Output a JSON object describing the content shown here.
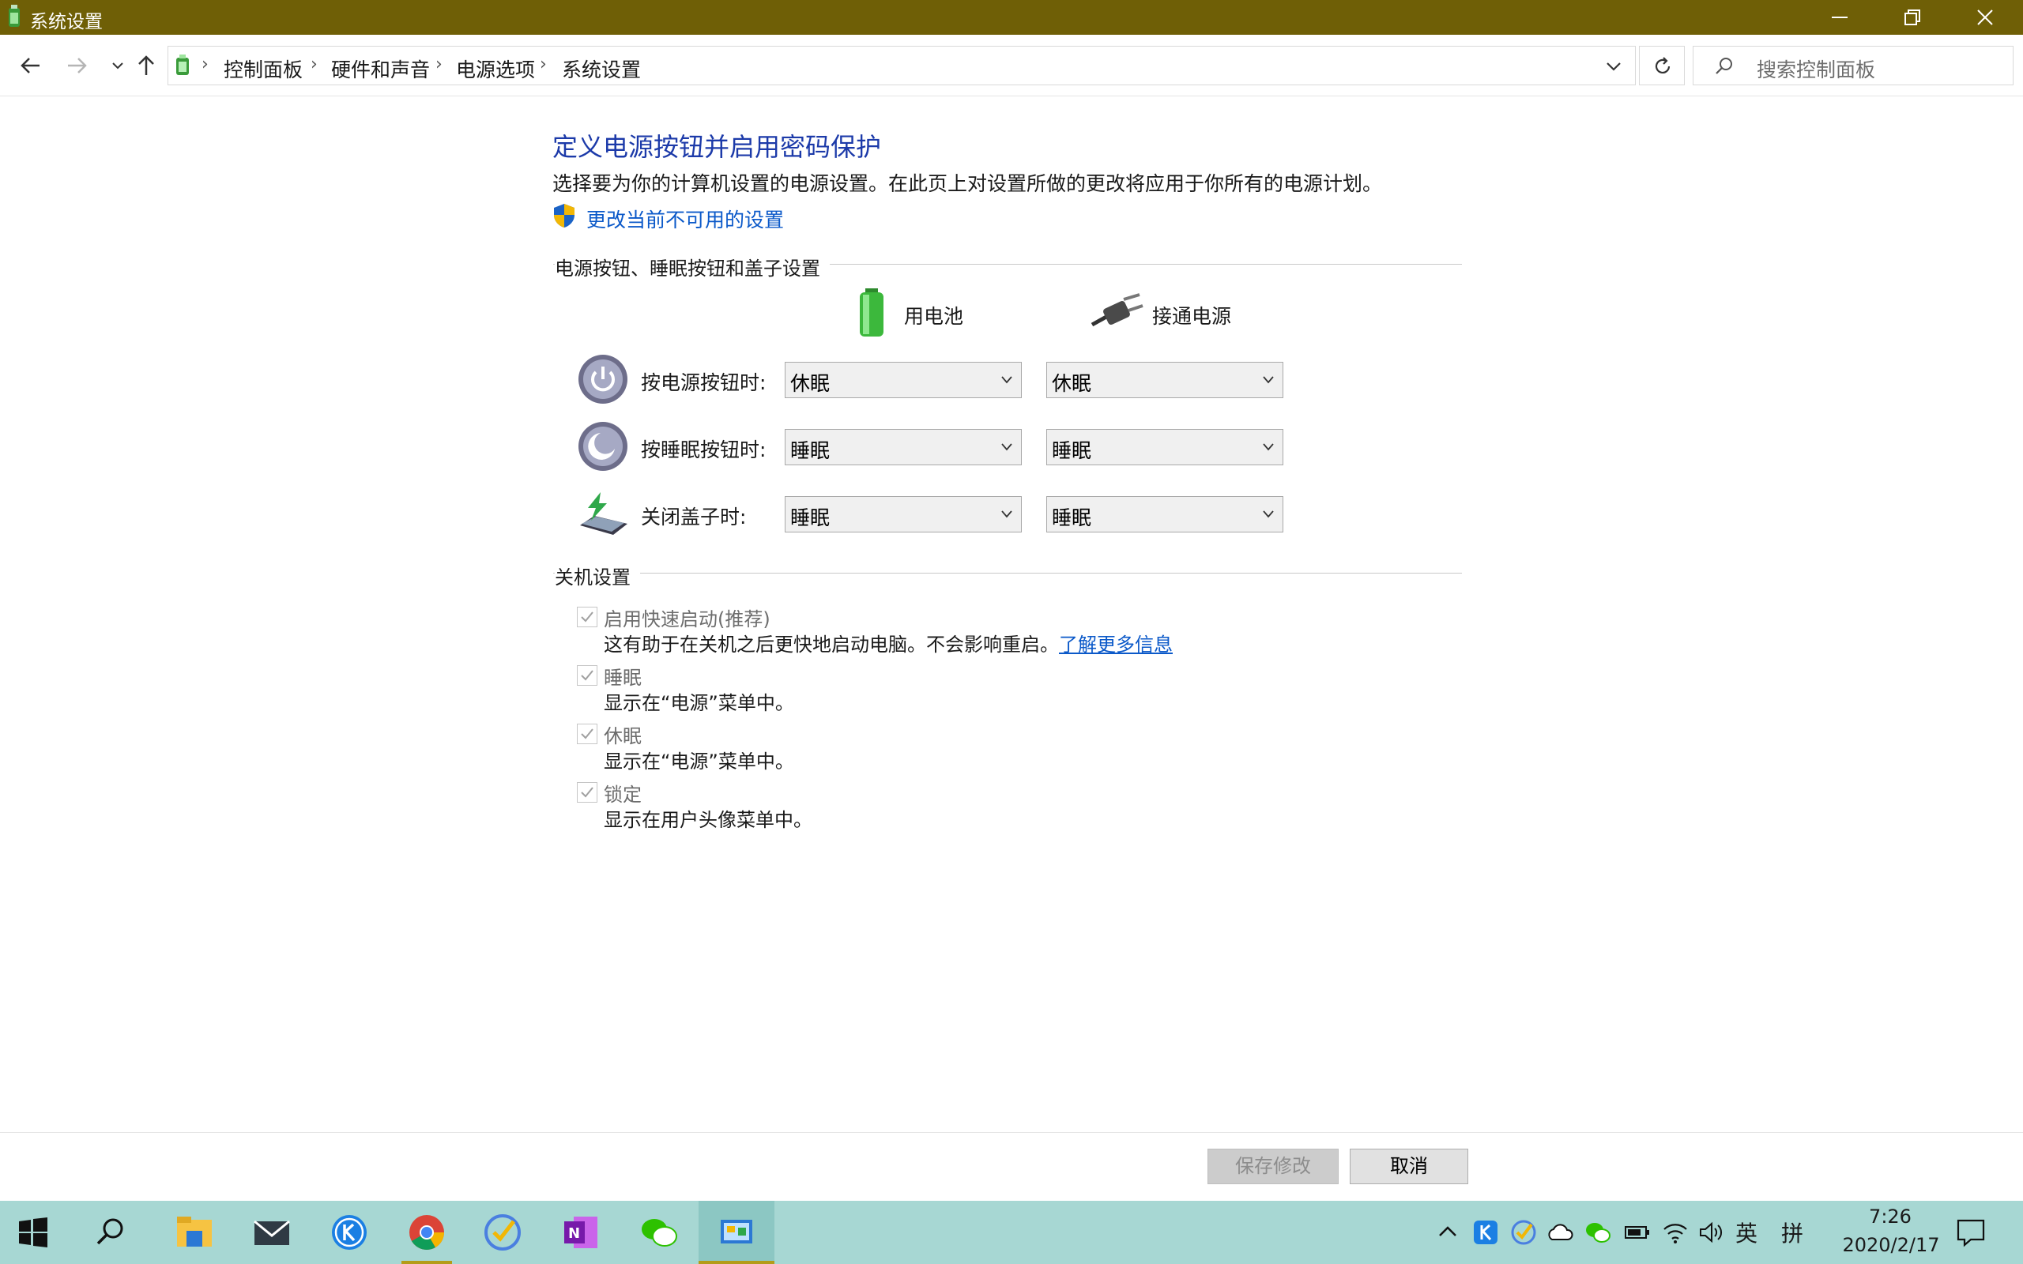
{
  "window": {
    "title": "系统设置",
    "title_bar_color": "#6f5f06"
  },
  "breadcrumb": {
    "items": [
      "控制面板",
      "硬件和声音",
      "电源选项",
      "系统设置"
    ],
    "separator": "›"
  },
  "search": {
    "placeholder": "搜索控制面板"
  },
  "page": {
    "heading": "定义电源按钮并启用密码保护",
    "description": "选择要为你的计算机设置的电源设置。在此页上对设置所做的更改将应用于你所有的电源计划。",
    "change_link": "更改当前不可用的设置"
  },
  "power_buttons": {
    "group_title": "电源按钮、睡眠按钮和盖子设置",
    "col_battery": "用电池",
    "col_plugged": "接通电源",
    "rows": [
      {
        "label": "按电源按钮时:",
        "battery": "休眠",
        "plugged": "休眠"
      },
      {
        "label": "按睡眠按钮时:",
        "battery": "睡眠",
        "plugged": "睡眠"
      },
      {
        "label": "关闭盖子时:",
        "battery": "睡眠",
        "plugged": "睡眠"
      }
    ]
  },
  "shutdown": {
    "group_title": "关机设置",
    "items": [
      {
        "title": "启用快速启动(推荐)",
        "desc": "这有助于在关机之后更快地启动电脑。不会影响重启。",
        "link": "了解更多信息",
        "checked": true,
        "disabled": true
      },
      {
        "title": "睡眠",
        "desc": "显示在“电源”菜单中。",
        "checked": true,
        "disabled": true
      },
      {
        "title": "休眠",
        "desc": "显示在“电源”菜单中。",
        "checked": true,
        "disabled": true
      },
      {
        "title": "锁定",
        "desc": "显示在用户头像菜单中。",
        "checked": true,
        "disabled": true
      }
    ]
  },
  "buttons": {
    "save": "保存修改",
    "cancel": "取消"
  },
  "taskbar": {
    "ime_lang": "英",
    "ime_mode": "拼",
    "time": "7:26",
    "date": "2020/2/17"
  }
}
